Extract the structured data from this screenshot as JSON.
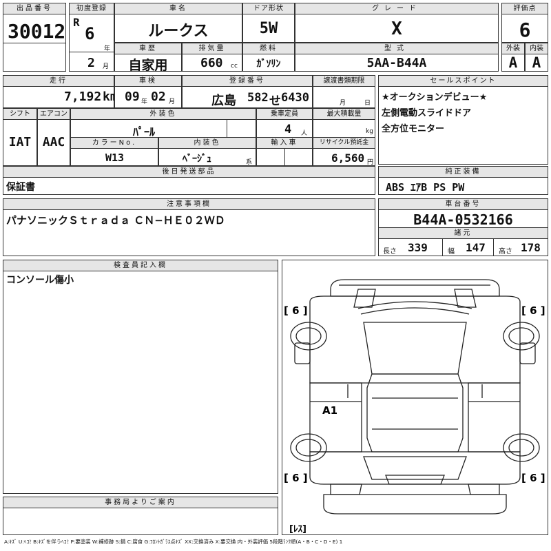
{
  "lot": {
    "label": "出品番号",
    "number": "30012"
  },
  "first_reg": {
    "label": "初度登録",
    "era": "R",
    "year": "6",
    "year_unit": "年",
    "month": "2",
    "month_unit": "月"
  },
  "car_name": {
    "label": "車名",
    "value": "ルークス"
  },
  "door": {
    "label": "ドア形状",
    "value": "5W"
  },
  "grade": {
    "label": "グレード",
    "value": "X"
  },
  "score": {
    "label": "評価点",
    "value": "6"
  },
  "history": {
    "label": "車歴",
    "value": "自家用"
  },
  "displacement": {
    "label": "排気量",
    "value": "660",
    "unit": "cc"
  },
  "fuel": {
    "label": "燃料",
    "value": "ｶﾞｿﾘﾝ"
  },
  "model_code": {
    "label": "型式",
    "value": "5AA-B44A"
  },
  "exterior_grade": {
    "label": "外装",
    "value": "A"
  },
  "interior_grade": {
    "label": "内装",
    "value": "A"
  },
  "mileage": {
    "label": "走行",
    "value": "7,192",
    "unit": "km"
  },
  "inspection": {
    "label": "車検",
    "year": "09",
    "year_unit": "年",
    "month": "02",
    "month_unit": "月"
  },
  "plate": {
    "label": "登録番号",
    "region": "広島",
    "class": "582",
    "kana": "せ",
    "number": "6430"
  },
  "transfer": {
    "label": "譲渡書類期限",
    "month_unit": "月",
    "day_unit": "日"
  },
  "shift": {
    "label": "シフト",
    "value": "IAT"
  },
  "aircon": {
    "label": "エアコン",
    "value": "AAC"
  },
  "ext_color": {
    "label": "外装色",
    "value": "ﾊﾟｰﾙ"
  },
  "capacity": {
    "label": "乗車定員",
    "value": "4",
    "unit": "人"
  },
  "max_load": {
    "label": "最大積載量",
    "unit": "kg"
  },
  "color_no": {
    "label": "カラーNo.",
    "value": "W13"
  },
  "int_color": {
    "label": "内装色",
    "value": "ﾍﾞｰｼﾞｭ",
    "unit": "系"
  },
  "import": {
    "label": "輸入車"
  },
  "recycle": {
    "label": "リサイクル預託金",
    "value": "6,560",
    "unit": "円"
  },
  "selling_points": {
    "label": "セールスポイント",
    "lines": [
      "★オークションデビュー★",
      "左側電動スライドドア",
      "全方位モニター"
    ]
  },
  "later_parts": {
    "label": "後日発送部品",
    "value": "保証書"
  },
  "genuine_equipment": {
    "label": "純正装備",
    "value": "ABS ｴｱB PS PW"
  },
  "notes": {
    "label": "注意事項欄",
    "value": "パナソニックＳｔｒａｄａ ＣＮ−ＨＥ０２ＷＤ"
  },
  "chassis": {
    "label": "車台番号",
    "value": "B44A-0532166"
  },
  "specs": {
    "label": "諸元",
    "length_label": "長さ",
    "length": "339",
    "width_label": "幅",
    "width": "147",
    "height_label": "高さ",
    "height": "178"
  },
  "inspector": {
    "label": "検査員記入欄",
    "value": "コンソール傷小"
  },
  "office": {
    "label": "事務局よりご案内"
  },
  "diagram": {
    "tire_fl": "[ 6 ]",
    "tire_fr": "[ 6 ]",
    "tire_rl": "[ 6 ]",
    "tire_rr": "[ 6 ]",
    "damage_mark": "A1",
    "spare": "[ﾚｽ]"
  },
  "legend": "A:ｷｽﾞ U:ﾍｺﾐ B:ｷｽﾞを伴うﾍｺﾐ P:要塗装 W:補修跡 S:錆 C:腐食 G:ﾌﾛﾝﾄｶﾞﾗｽ点ｷｽﾞ XX:交換済み X:要交換 内・外装評価 5段階ﾗﾝｸ順(A・B・C・D・E) 1"
}
